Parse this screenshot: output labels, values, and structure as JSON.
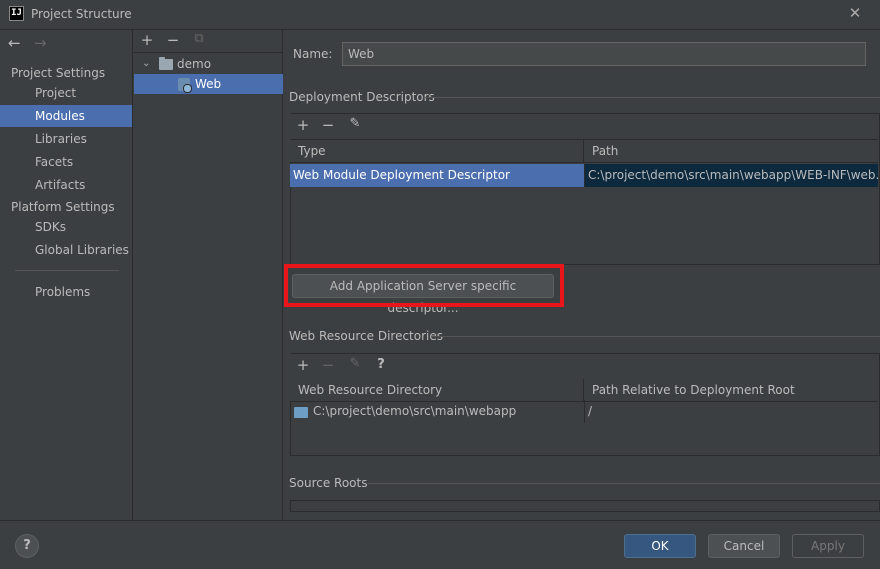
{
  "window": {
    "title": "Project Structure",
    "app_icon_text": "IJ"
  },
  "left_nav": {
    "groups": [
      {
        "label": "Project Settings",
        "items": [
          "Project",
          "Modules",
          "Libraries",
          "Facets",
          "Artifacts"
        ]
      },
      {
        "label": "Platform Settings",
        "items": [
          "SDKs",
          "Global Libraries"
        ]
      }
    ],
    "extra_items": [
      "Problems"
    ],
    "selected": "Modules"
  },
  "module_tree": {
    "items": [
      {
        "label": "demo",
        "icon": "folder-icon",
        "expanded": true
      },
      {
        "label": "Web",
        "icon": "web-facet-icon",
        "selected": true
      }
    ]
  },
  "facet": {
    "name_label": "Name:",
    "name_value": "Web",
    "deployment_descriptors": {
      "title": "Deployment Descriptors",
      "columns": [
        "Type",
        "Path"
      ],
      "rows": [
        {
          "type": "Web Module Deployment Descriptor",
          "path": "C:\\project\\demo\\src\\main\\webapp\\WEB-INF\\web.xml"
        }
      ]
    },
    "add_server_descriptor_label": "Add Application Server specific descriptor...",
    "web_resource_directories": {
      "title": "Web Resource Directories",
      "columns": [
        "Web Resource Directory",
        "Path Relative to Deployment Root"
      ],
      "rows": [
        {
          "directory": "C:\\project\\demo\\src\\main\\webapp",
          "relative": "/"
        }
      ],
      "help_label": "?"
    },
    "source_roots": {
      "title": "Source Roots"
    }
  },
  "footer": {
    "help_label": "?",
    "ok_label": "OK",
    "cancel_label": "Cancel",
    "apply_label": "Apply"
  },
  "colors": {
    "background": "#3c3f41",
    "selection": "#4b6eaf",
    "primary_button": "#365880",
    "highlight_border": "#e8151b"
  }
}
